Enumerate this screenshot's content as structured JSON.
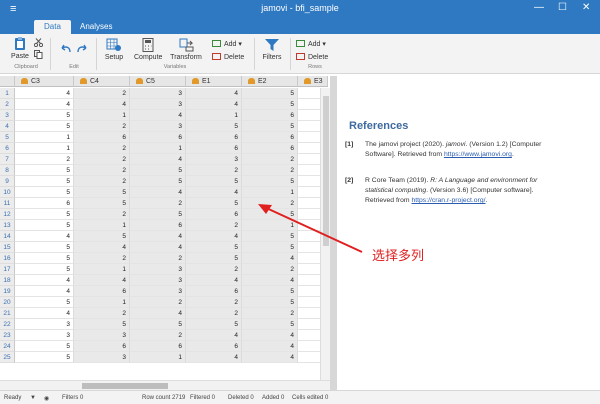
{
  "titlebar": {
    "app_title": "jamovi - bfi_sample",
    "menu_glyph": "≡",
    "minimize": "—",
    "maximize": "☐",
    "close": "✕"
  },
  "tabs": [
    {
      "label": "Data"
    },
    {
      "label": "Analyses"
    }
  ],
  "ribbon": {
    "paste": "Paste",
    "clipboard_group": "Clipboard",
    "edit_group": "Edit",
    "setup": "Setup",
    "compute": "Compute",
    "transform": "Transform",
    "add": "Add",
    "delete": "Delete",
    "variables_group": "Variables",
    "filters": "Filters",
    "rows_add": "Add",
    "rows_delete": "Delete",
    "rows_group": "Rows"
  },
  "columns": [
    "C3",
    "C4",
    "C5",
    "E1",
    "E2",
    "E3"
  ],
  "rows": [
    [
      4,
      2,
      3,
      4,
      5
    ],
    [
      4,
      4,
      3,
      4,
      5
    ],
    [
      5,
      1,
      4,
      1,
      6
    ],
    [
      5,
      2,
      3,
      5,
      5
    ],
    [
      1,
      6,
      6,
      6,
      6
    ],
    [
      1,
      2,
      1,
      6,
      6
    ],
    [
      2,
      2,
      4,
      3,
      2
    ],
    [
      5,
      2,
      5,
      2,
      2
    ],
    [
      5,
      2,
      5,
      5,
      5
    ],
    [
      5,
      5,
      4,
      4,
      1
    ],
    [
      6,
      5,
      2,
      5,
      2
    ],
    [
      5,
      2,
      5,
      6,
      5
    ],
    [
      5,
      1,
      6,
      2,
      1
    ],
    [
      4,
      5,
      4,
      4,
      5
    ],
    [
      5,
      4,
      4,
      5,
      5
    ],
    [
      5,
      2,
      2,
      5,
      4
    ],
    [
      5,
      1,
      3,
      2,
      2
    ],
    [
      4,
      4,
      3,
      4,
      4
    ],
    [
      4,
      6,
      3,
      6,
      5
    ],
    [
      5,
      1,
      2,
      2,
      5
    ],
    [
      4,
      2,
      4,
      2,
      2
    ],
    [
      3,
      5,
      5,
      5,
      5
    ],
    [
      3,
      3,
      2,
      4,
      4
    ],
    [
      5,
      6,
      6,
      6,
      4
    ],
    [
      5,
      3,
      1,
      4,
      4
    ]
  ],
  "results": {
    "heading": "References",
    "refs": [
      {
        "num": "[1]",
        "pre": "The jamovi project (2020). ",
        "title": "jamovi",
        "post": ". (Version 1.2) [Computer Software]. Retrieved from ",
        "link": "https://www.jamovi.org",
        "end": "."
      },
      {
        "num": "[2]",
        "pre": "R Core Team (2019). ",
        "title": "R: A Language and environment for statistical computing",
        "post": ". (Version 3.6) [Computer software]. Retrieved from ",
        "link": "https://cran.r-project.org/",
        "end": "."
      }
    ]
  },
  "annotation": "选择多列",
  "status": {
    "ready": "Ready",
    "filters": "Filters 0",
    "row_count": "Row count 2719",
    "filtered": "Filtered 0",
    "deleted": "Deleted 0",
    "added": "Added 0",
    "cells_edited": "Cells edited 0"
  },
  "colors": {
    "accent": "#2f79c2",
    "annotation": "#e02020",
    "heading": "#3e6aa1"
  }
}
